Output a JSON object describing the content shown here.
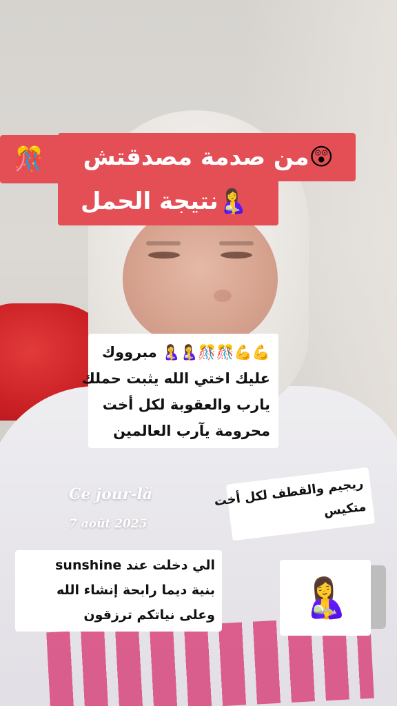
{
  "banner": {
    "line1": "من صدمة مصدقتش",
    "line1_emojis": "😲🎊",
    "line2": "نتيجة الحمل",
    "line2_emoji": "🤱",
    "bg_color": "#e34f55"
  },
  "comment_card": {
    "lines": [
      "💪💪🎊🎊🤱🤱 مبرووك",
      "عليك اختي الله يثبت حملك",
      "يارب والعقوبة لكل أخت",
      "محرومة يآرب العالمين"
    ]
  },
  "diet_card": {
    "lines": [
      "ريجيم والقطف لكل أخت",
      "متكيس"
    ]
  },
  "sunshine_card": {
    "lines": [
      "الي دخلت عند sunshine",
      "بنية ديما رابحة إنشاء الله",
      "وعلى نياتكم ترزقون"
    ]
  },
  "emoji_sticker": {
    "emoji": "🤱",
    "icon": "breastfeeding-emoji"
  },
  "memory": {
    "title": "Ce jour-là",
    "date": "7 août 2025"
  }
}
